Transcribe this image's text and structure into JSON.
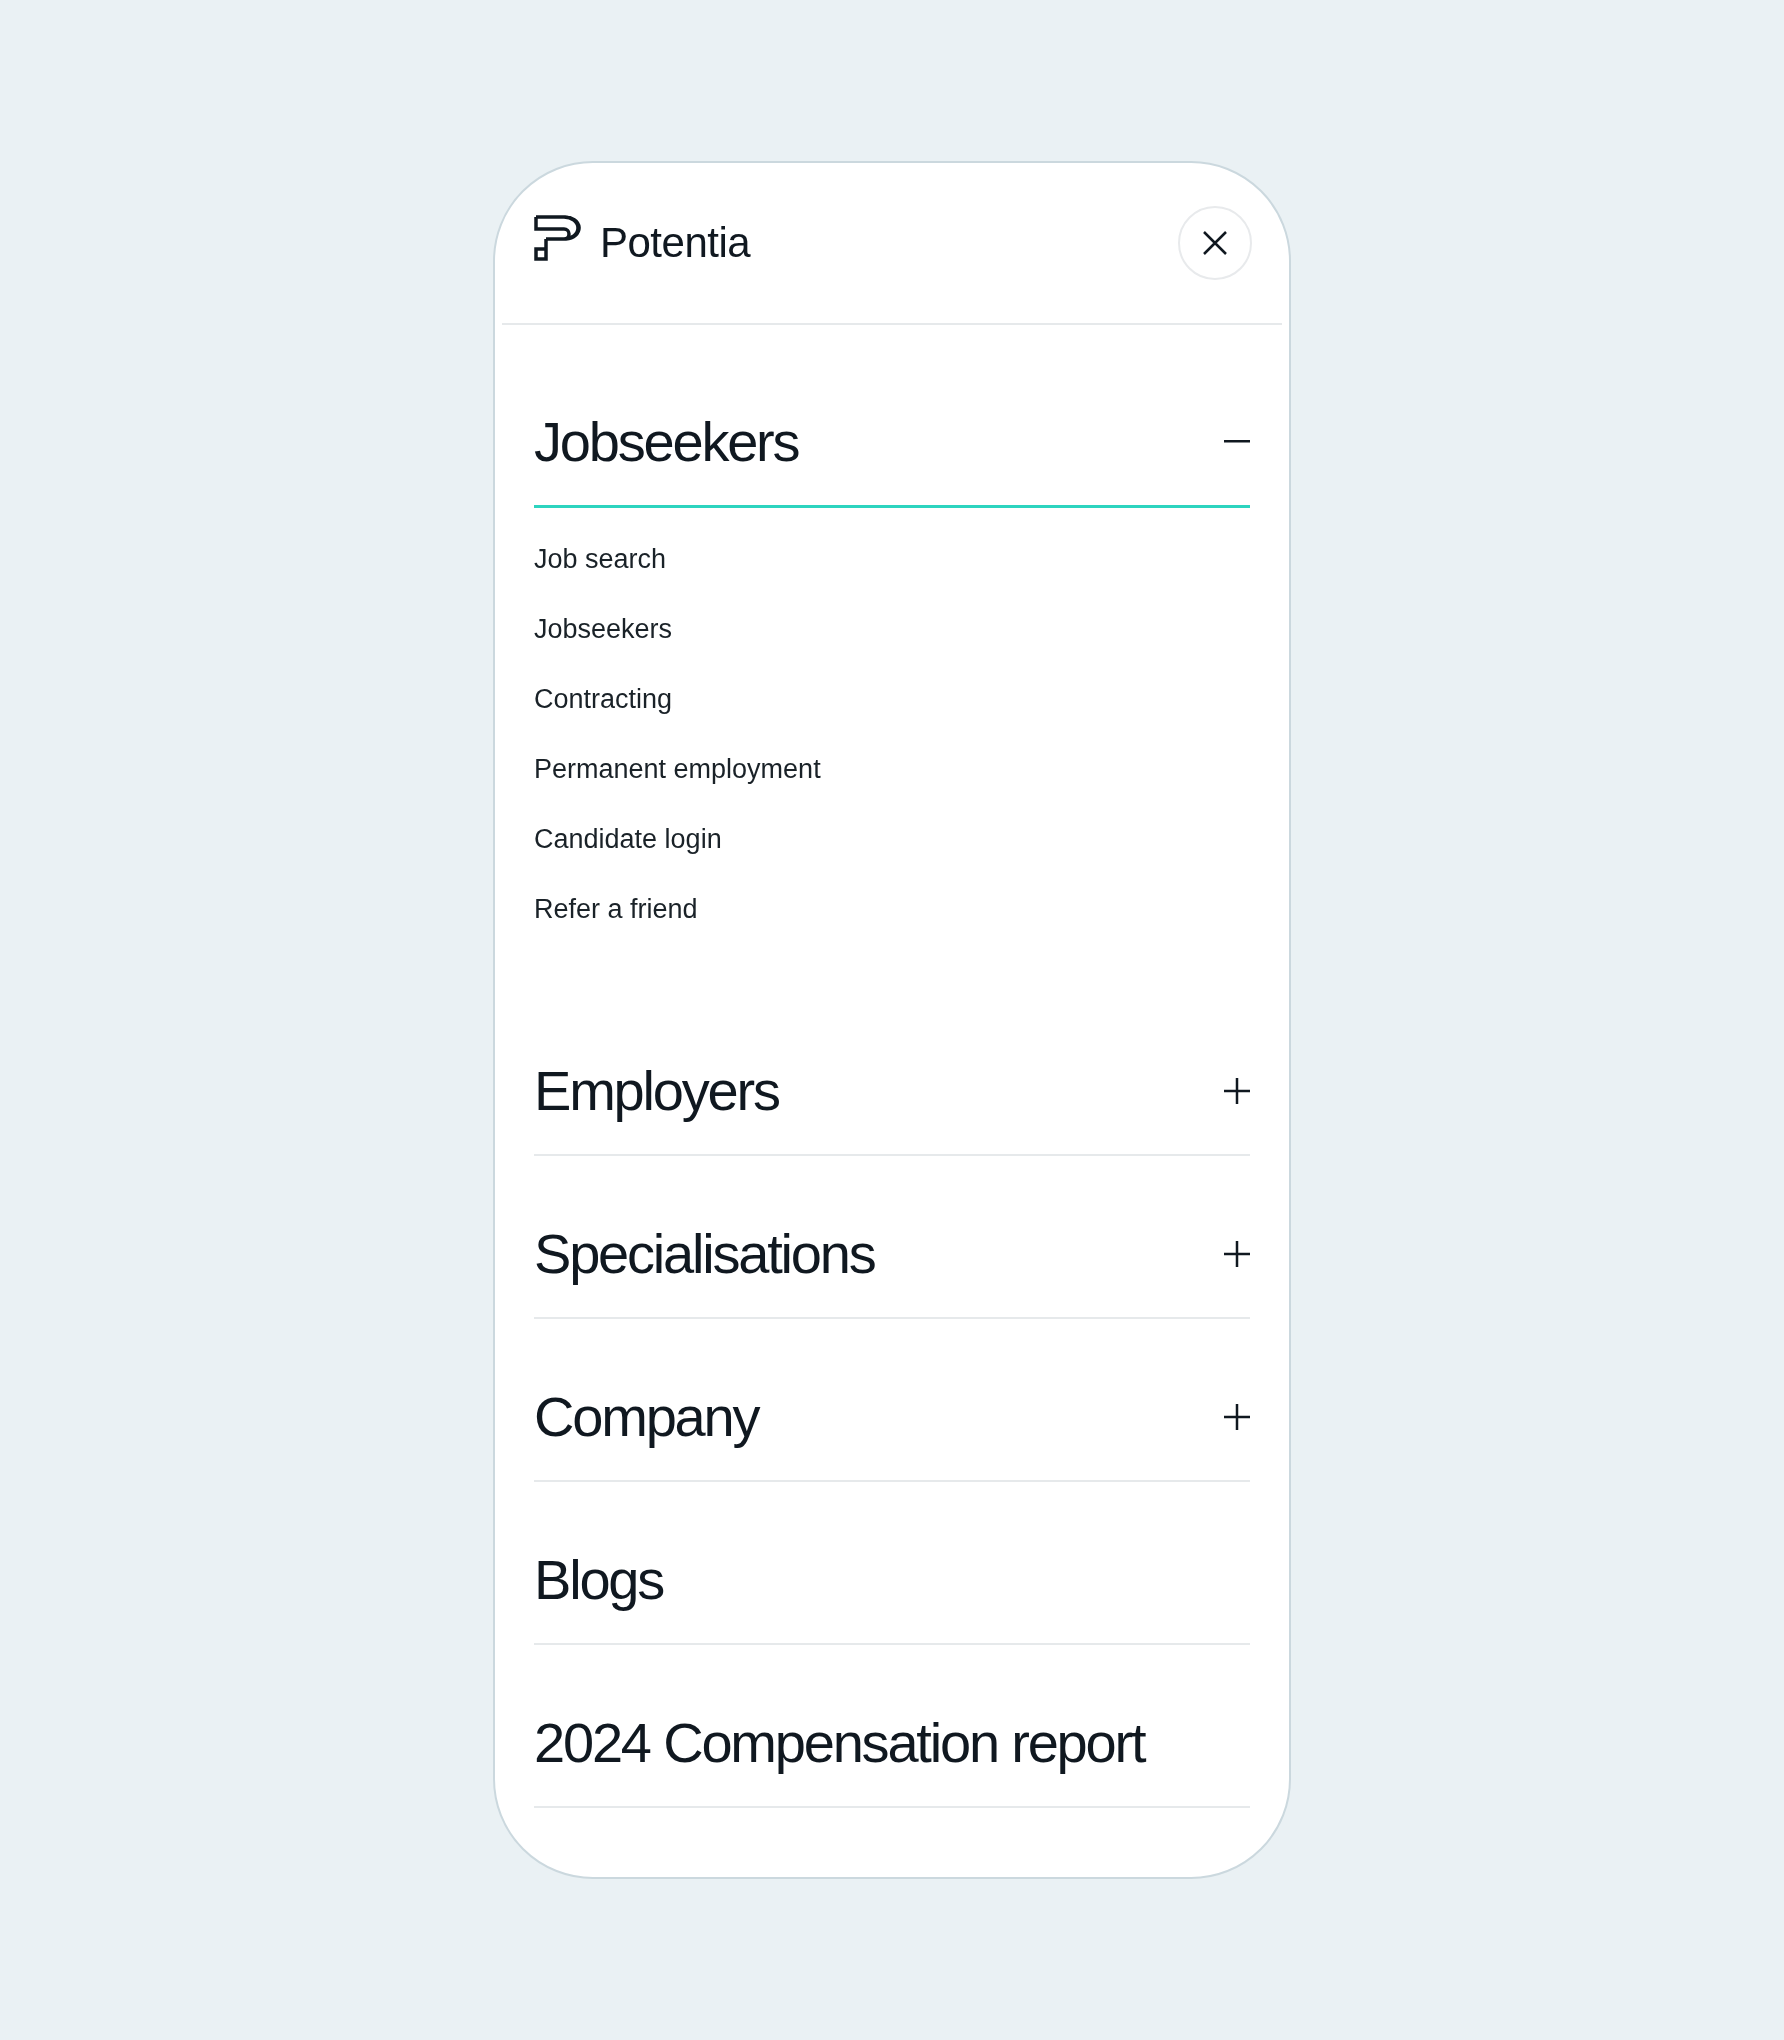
{
  "header": {
    "brand": "Potentia"
  },
  "menu": [
    {
      "title": "Jobseekers",
      "kind": "accordion",
      "expanded": true,
      "items": [
        "Job search",
        "Jobseekers",
        "Contracting",
        "Permanent employment",
        "Candidate login",
        "Refer a friend"
      ]
    },
    {
      "title": "Employers",
      "kind": "accordion",
      "expanded": false
    },
    {
      "title": "Specialisations",
      "kind": "accordion",
      "expanded": false
    },
    {
      "title": "Company",
      "kind": "accordion",
      "expanded": false
    },
    {
      "title": "Blogs",
      "kind": "link"
    },
    {
      "title": "2024 Compensation report",
      "kind": "link"
    }
  ]
}
